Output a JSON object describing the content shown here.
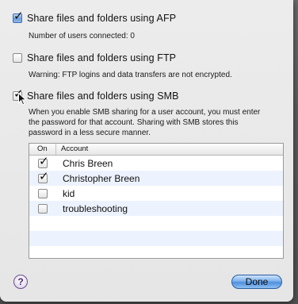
{
  "options": {
    "afp": {
      "label": "Share files and folders using AFP",
      "checked": true,
      "description": "Number of users connected: 0"
    },
    "ftp": {
      "label": "Share files and folders using FTP",
      "checked": false,
      "description": "Warning: FTP logins and data transfers are not encrypted."
    },
    "smb": {
      "label": "Share files and folders using SMB",
      "checked": true,
      "description_lines": [
        "When you enable SMB sharing for a user account, you must enter",
        "the password for that account. Sharing with SMB stores this",
        "password in a less secure manner."
      ]
    }
  },
  "accounts_table": {
    "headers": {
      "on": "On",
      "account": "Account"
    },
    "rows": [
      {
        "name": "Chris Breen",
        "on": true
      },
      {
        "name": "Christopher Breen",
        "on": true
      },
      {
        "name": "kid",
        "on": false
      },
      {
        "name": "troubleshooting",
        "on": false
      }
    ]
  },
  "buttons": {
    "help": "?",
    "done": "Done"
  },
  "icons": {
    "check": "checkmark-icon",
    "help": "question-icon",
    "cursor": "pointer-cursor-icon"
  },
  "colors": {
    "accent": "#4f90df",
    "alt_row": "#edf3fe"
  }
}
